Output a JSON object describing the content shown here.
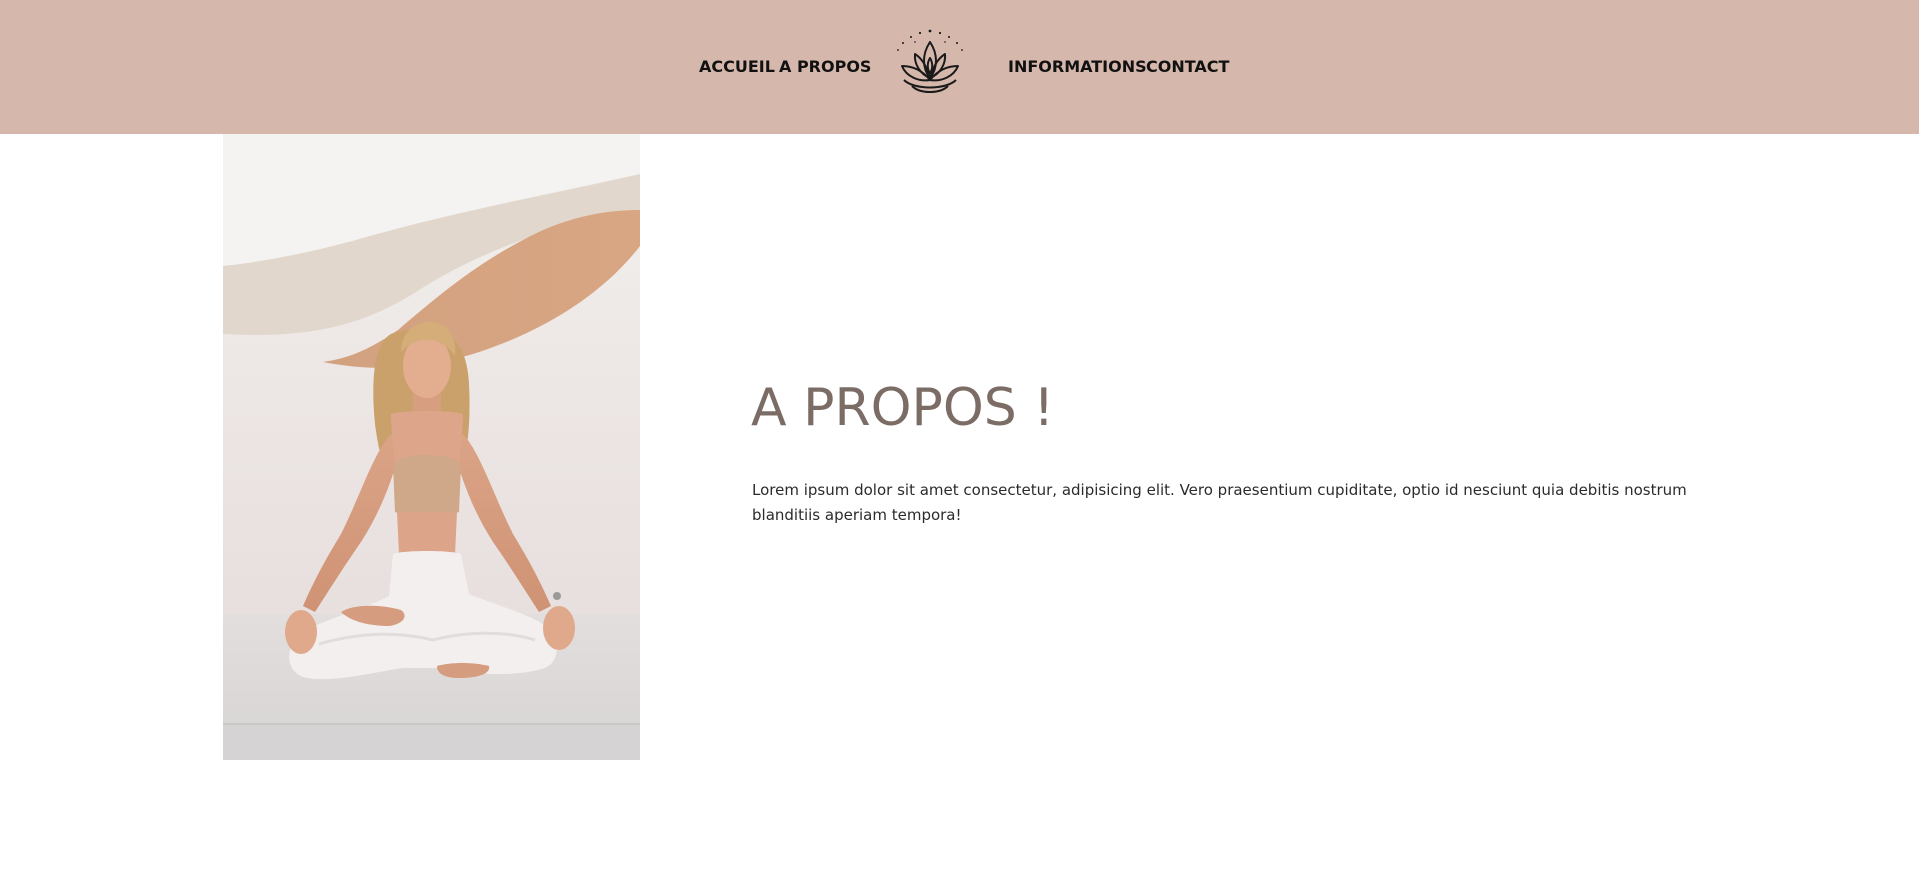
{
  "nav": {
    "left": [
      {
        "label": "ACCUEIL"
      },
      {
        "label": "A PROPOS"
      }
    ],
    "right": [
      {
        "label": "INFORMATIONS"
      },
      {
        "label": "CONTACT"
      }
    ],
    "logo_icon": "lotus-icon"
  },
  "main": {
    "photo_alt": "woman meditating in lotus pose",
    "title": "A PROPOS !",
    "body": "Lorem ipsum dolor sit amet consectetur, adipisicing elit. Vero praesentium cupiditate, optio id nesciunt quia debitis nostrum blanditiis aperiam tempora!"
  },
  "colors": {
    "header_bg": "#d5b7ab",
    "title": "#7b6c65",
    "text": "#2b2b2b"
  }
}
